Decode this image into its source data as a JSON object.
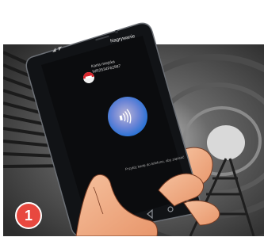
{
  "status": {
    "icons": "◢ ◤"
  },
  "screen": {
    "title": "Nagrywanie",
    "card_title": "Karta miejska",
    "card_number": "WR2534F62987",
    "nfc_caption": "Przyłóż kartę do telefonu, aby zapisać"
  },
  "badge": {
    "number": "1"
  },
  "colors": {
    "badge": "#e8483f",
    "nfc_gradient_outer": "#1d6fd1",
    "nfc_gradient_inner": "#9fb0d8",
    "phone_body": "#111316",
    "skin": "#f2b08a"
  }
}
